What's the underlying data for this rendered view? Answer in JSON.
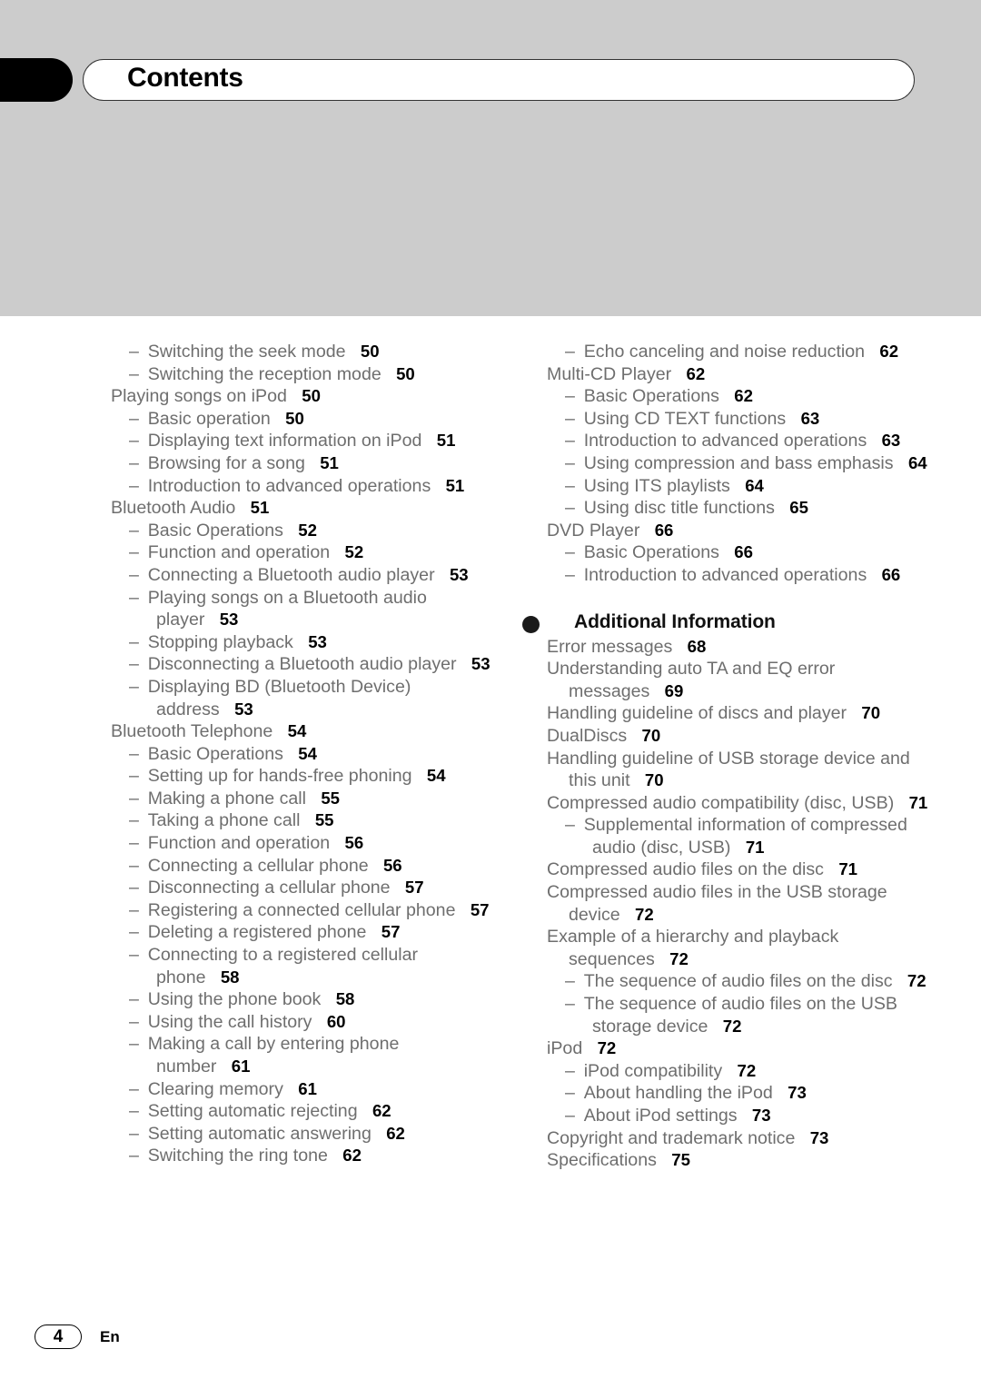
{
  "header": {
    "title": "Contents"
  },
  "footer": {
    "page_number": "4",
    "language_code": "En"
  },
  "columns": {
    "left": [
      {
        "level": 2,
        "text": "Switching the seek mode",
        "page": "50"
      },
      {
        "level": 2,
        "text": "Switching the reception mode",
        "page": "50"
      },
      {
        "level": 1,
        "text": "Playing songs on iPod",
        "page": "50"
      },
      {
        "level": 2,
        "text": "Basic operation",
        "page": "50"
      },
      {
        "level": 2,
        "text": "Displaying text information on iPod",
        "page": "51"
      },
      {
        "level": 2,
        "text": "Browsing for a song",
        "page": "51"
      },
      {
        "level": 2,
        "text": "Introduction to advanced operations",
        "page": "51"
      },
      {
        "level": 1,
        "text": "Bluetooth Audio",
        "page": "51"
      },
      {
        "level": 2,
        "text": "Basic Operations",
        "page": "52"
      },
      {
        "level": 2,
        "text": "Function and operation",
        "page": "52"
      },
      {
        "level": 2,
        "text": "Connecting a Bluetooth audio player",
        "page": "53"
      },
      {
        "level": 2,
        "text": "Playing songs on a Bluetooth audio player",
        "page": "53"
      },
      {
        "level": 2,
        "text": "Stopping playback",
        "page": "53"
      },
      {
        "level": 2,
        "text": "Disconnecting a Bluetooth audio player",
        "page": "53"
      },
      {
        "level": 2,
        "text": "Displaying BD (Bluetooth Device) address",
        "page": "53"
      },
      {
        "level": 1,
        "text": "Bluetooth Telephone",
        "page": "54"
      },
      {
        "level": 2,
        "text": "Basic Operations",
        "page": "54"
      },
      {
        "level": 2,
        "text": "Setting up for hands-free phoning",
        "page": "54"
      },
      {
        "level": 2,
        "text": "Making a phone call",
        "page": "55"
      },
      {
        "level": 2,
        "text": "Taking a phone call",
        "page": "55"
      },
      {
        "level": 2,
        "text": "Function and operation",
        "page": "56"
      },
      {
        "level": 2,
        "text": "Connecting a cellular phone",
        "page": "56"
      },
      {
        "level": 2,
        "text": "Disconnecting a cellular phone",
        "page": "57"
      },
      {
        "level": 2,
        "text": "Registering a connected cellular phone",
        "page": "57"
      },
      {
        "level": 2,
        "text": "Deleting a registered phone",
        "page": "57"
      },
      {
        "level": 2,
        "text": "Connecting to a registered cellular phone",
        "page": "58"
      },
      {
        "level": 2,
        "text": "Using the phone book",
        "page": "58"
      },
      {
        "level": 2,
        "text": "Using the call history",
        "page": "60"
      },
      {
        "level": 2,
        "text": "Making a call by entering phone number",
        "page": "61"
      },
      {
        "level": 2,
        "text": "Clearing memory",
        "page": "61"
      },
      {
        "level": 2,
        "text": "Setting automatic rejecting",
        "page": "62"
      },
      {
        "level": 2,
        "text": "Setting automatic answering",
        "page": "62"
      },
      {
        "level": 2,
        "text": "Switching the ring tone",
        "page": "62"
      }
    ],
    "right": [
      {
        "level": 2,
        "text": "Echo canceling and noise reduction",
        "page": "62"
      },
      {
        "level": 1,
        "text": "Multi-CD Player",
        "page": "62"
      },
      {
        "level": 2,
        "text": "Basic Operations",
        "page": "62"
      },
      {
        "level": 2,
        "text": "Using CD TEXT functions",
        "page": "63"
      },
      {
        "level": 2,
        "text": "Introduction to advanced operations",
        "page": "63"
      },
      {
        "level": 2,
        "text": "Using compression and bass emphasis",
        "page": "64"
      },
      {
        "level": 2,
        "text": "Using ITS playlists",
        "page": "64"
      },
      {
        "level": 2,
        "text": "Using disc title functions",
        "page": "65"
      },
      {
        "level": 1,
        "text": "DVD Player",
        "page": "66"
      },
      {
        "level": 2,
        "text": "Basic Operations",
        "page": "66"
      },
      {
        "level": 2,
        "text": "Introduction to advanced operations",
        "page": "66"
      }
    ],
    "right_section": {
      "heading": "Additional Information",
      "bullet_icon": "filled-circle-icon",
      "items": [
        {
          "level": 1,
          "text": "Error messages",
          "page": "68"
        },
        {
          "level": 1,
          "text": "Understanding auto TA and EQ error messages",
          "page": "69"
        },
        {
          "level": 1,
          "text": "Handling guideline of discs and player",
          "page": "70"
        },
        {
          "level": 1,
          "text": "DualDiscs",
          "page": "70"
        },
        {
          "level": 1,
          "text": "Handling guideline of USB storage device and this unit",
          "page": "70"
        },
        {
          "level": 1,
          "text": "Compressed audio compatibility (disc, USB)",
          "page": "71"
        },
        {
          "level": 2,
          "text": "Supplemental information of compressed audio (disc, USB)",
          "page": "71"
        },
        {
          "level": 1,
          "text": "Compressed audio files on the disc",
          "page": "71"
        },
        {
          "level": 1,
          "text": "Compressed audio files in the USB storage device",
          "page": "72"
        },
        {
          "level": 1,
          "text": "Example of a hierarchy and playback sequences",
          "page": "72"
        },
        {
          "level": 2,
          "text": "The sequence of audio files on the disc",
          "page": "72"
        },
        {
          "level": 2,
          "text": "The sequence of audio files on the USB storage device",
          "page": "72"
        },
        {
          "level": 1,
          "text": "iPod",
          "page": "72"
        },
        {
          "level": 2,
          "text": "iPod compatibility",
          "page": "72"
        },
        {
          "level": 2,
          "text": "About handling the iPod",
          "page": "73"
        },
        {
          "level": 2,
          "text": "About iPod settings",
          "page": "73"
        },
        {
          "level": 1,
          "text": "Copyright and trademark notice",
          "page": "73"
        },
        {
          "level": 1,
          "text": "Specifications",
          "page": "75"
        }
      ]
    }
  }
}
